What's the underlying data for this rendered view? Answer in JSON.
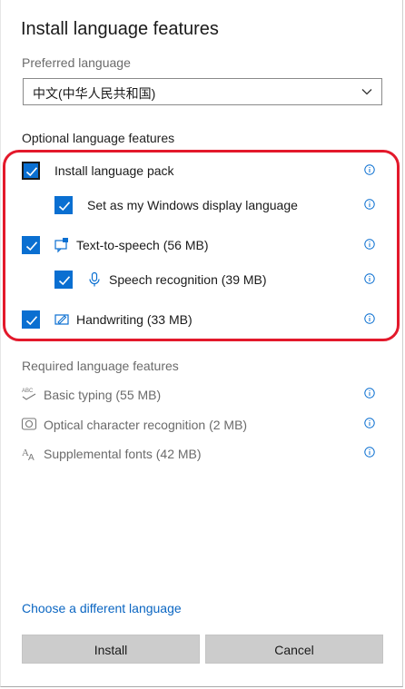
{
  "window": {
    "title": "Install language features"
  },
  "preferred": {
    "label": "Preferred language",
    "selected": "中文(中华人民共和国)"
  },
  "optional": {
    "label": "Optional language features",
    "items": [
      {
        "label": "Install language pack",
        "checked": true
      },
      {
        "label": "Set as my Windows display language",
        "checked": true
      },
      {
        "label": "Text-to-speech (56 MB)",
        "checked": true,
        "icon": "speech-bubble-icon"
      },
      {
        "label": "Speech recognition (39 MB)",
        "checked": true,
        "icon": "microphone-icon"
      },
      {
        "label": "Handwriting (33 MB)",
        "checked": true,
        "icon": "pen-icon"
      }
    ]
  },
  "required": {
    "label": "Required language features",
    "items": [
      {
        "label": "Basic typing (55 MB)",
        "icon": "abc-icon"
      },
      {
        "label": "Optical character recognition (2 MB)",
        "icon": "camera-icon"
      },
      {
        "label": "Supplemental fonts (42 MB)",
        "icon": "font-icon"
      }
    ]
  },
  "footer": {
    "link": "Choose a different language",
    "install": "Install",
    "cancel": "Cancel"
  },
  "colors": {
    "accent": "#0a6fd1",
    "highlight": "#e3192b",
    "link": "#0b66c2"
  }
}
